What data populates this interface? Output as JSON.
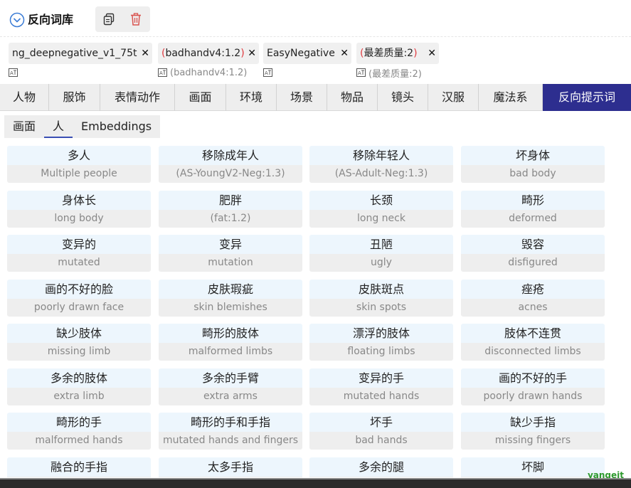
{
  "header": {
    "title": "反向词库"
  },
  "tags": [
    {
      "chip": "ng_deepnegative_v1_75t",
      "translation": ""
    },
    {
      "chip_open": "(",
      "chip_body": "badhandv4:1.2",
      "chip_close": ")",
      "translation": "(badhandv4:1.2)"
    },
    {
      "chip": "EasyNegative",
      "translation": ""
    },
    {
      "chip_open": "(",
      "chip_body": "最差质量:2",
      "chip_close": ")",
      "translation": "(最差质量:2)"
    }
  ],
  "close_glyph": "✕",
  "categories": [
    "人物",
    "服饰",
    "表情动作",
    "画面",
    "环境",
    "场景",
    "物品",
    "镜头",
    "汉服",
    "魔法系",
    "反向提示词"
  ],
  "active_category": "反向提示词",
  "subtabs": [
    "画面",
    "人",
    "Embeddings"
  ],
  "active_subtab": "人",
  "cards": [
    {
      "zh": "多人",
      "en": "Multiple people"
    },
    {
      "zh": "移除成年人",
      "en": "(AS-YoungV2-Neg:1.3)"
    },
    {
      "zh": "移除年轻人",
      "en": "(AS-Adult-Neg:1.3)"
    },
    {
      "zh": "坏身体",
      "en": "bad body"
    },
    {
      "zh": "身体长",
      "en": "long body"
    },
    {
      "zh": "肥胖",
      "en": "(fat:1.2)"
    },
    {
      "zh": "长颈",
      "en": "long neck"
    },
    {
      "zh": "畸形",
      "en": "deformed"
    },
    {
      "zh": "变异的",
      "en": "mutated"
    },
    {
      "zh": "变异",
      "en": "mutation"
    },
    {
      "zh": "丑陋",
      "en": "ugly"
    },
    {
      "zh": "毁容",
      "en": "disfigured"
    },
    {
      "zh": "画的不好的脸",
      "en": "poorly drawn face"
    },
    {
      "zh": "皮肤瑕疵",
      "en": "skin blemishes"
    },
    {
      "zh": "皮肤斑点",
      "en": "skin spots"
    },
    {
      "zh": "痤疮",
      "en": "acnes"
    },
    {
      "zh": "缺少肢体",
      "en": "missing limb"
    },
    {
      "zh": "畸形的肢体",
      "en": "malformed limbs"
    },
    {
      "zh": "漂浮的肢体",
      "en": "floating limbs"
    },
    {
      "zh": "肢体不连贯",
      "en": "disconnected limbs"
    },
    {
      "zh": "多余的肢体",
      "en": "extra limb"
    },
    {
      "zh": "多余的手臂",
      "en": "extra arms"
    },
    {
      "zh": "变异的手",
      "en": "mutated hands"
    },
    {
      "zh": "画的不好的手",
      "en": "poorly drawn hands"
    },
    {
      "zh": "畸形的手",
      "en": "malformed hands"
    },
    {
      "zh": "畸形的手和手指",
      "en": "mutated hands and fingers"
    },
    {
      "zh": "坏手",
      "en": "bad hands"
    },
    {
      "zh": "缺少手指",
      "en": "missing fingers"
    },
    {
      "zh": "融合的手指",
      "en": ""
    },
    {
      "zh": "太多手指",
      "en": ""
    },
    {
      "zh": "多余的腿",
      "en": ""
    },
    {
      "zh": "坏脚",
      "en": ""
    }
  ],
  "watermark": "yangeit",
  "colors": {
    "accent": "#2d2e8f",
    "paren": "#e0393e",
    "chevron": "#3a7bd5",
    "delete": "#d9534f",
    "card_top": "#edf6fd"
  }
}
